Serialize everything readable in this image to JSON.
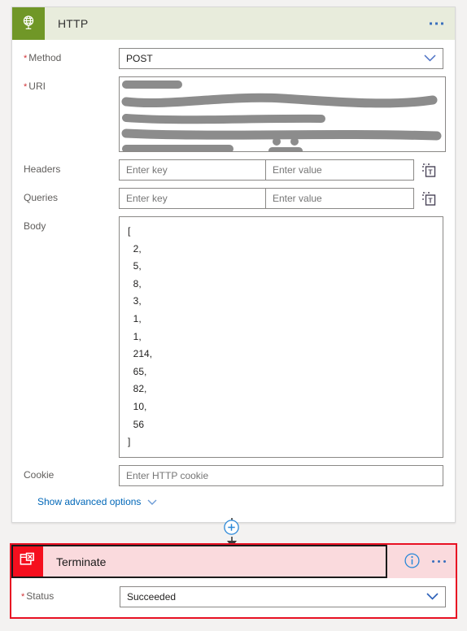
{
  "http_card": {
    "icon": "globe-network-icon",
    "title": "HTTP",
    "accent_color": "#709727",
    "header_bg": "#e8ecdc",
    "menu": "overflow-menu",
    "fields": {
      "method": {
        "label": "Method",
        "required": true,
        "value": "POST",
        "control": "dropdown"
      },
      "uri": {
        "label": "URI",
        "required": true,
        "value": "",
        "note": "content redacted with gray marker strokes"
      },
      "headers": {
        "label": "Headers",
        "required": false,
        "key_placeholder": "Enter key",
        "value_placeholder": "Enter value",
        "key_value": "",
        "value_value": "",
        "mode_icon": "switch-to-text-mode-icon"
      },
      "queries": {
        "label": "Queries",
        "required": false,
        "key_placeholder": "Enter key",
        "value_placeholder": "Enter value",
        "key_value": "",
        "value_value": "",
        "mode_icon": "switch-to-text-mode-icon"
      },
      "body": {
        "label": "Body",
        "required": false,
        "lines": [
          "[",
          "  2,",
          "  5,",
          "  8,",
          "  3,",
          "  1,",
          "  1,",
          "  214,",
          "  65,",
          "  82,",
          "  10,",
          "  56",
          "]"
        ]
      },
      "cookie": {
        "label": "Cookie",
        "required": false,
        "placeholder": "Enter HTTP cookie",
        "value": ""
      }
    },
    "advanced_options": {
      "label": "Show advanced options",
      "chevron": "chevron-down-icon",
      "color": "#0067b8"
    }
  },
  "connector": {
    "add_button": "add-step-button",
    "arrow": "arrow-down-icon"
  },
  "terminate_card": {
    "icon": "terminate-icon",
    "title": "Terminate",
    "accent_color": "#f50f1e",
    "header_bg": "#fadadd",
    "border_color": "#e81123",
    "selected": true,
    "info_icon": "info-icon",
    "menu": "overflow-menu",
    "fields": {
      "status": {
        "label": "Status",
        "required": true,
        "value": "Succeeded",
        "control": "dropdown"
      }
    }
  }
}
